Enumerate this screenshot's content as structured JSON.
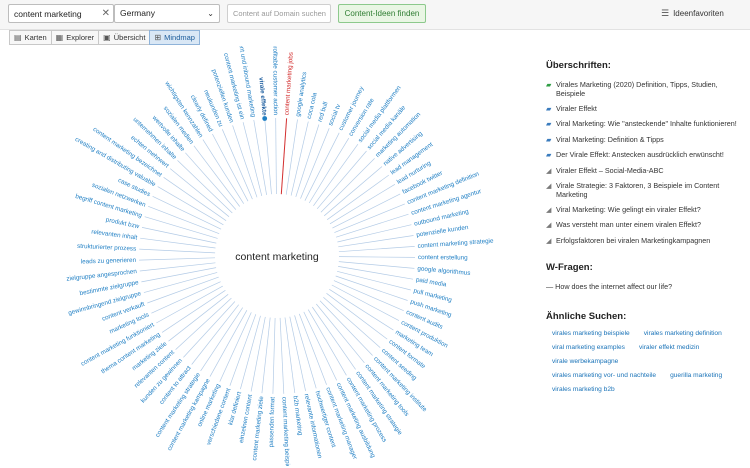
{
  "toolbar": {
    "search_value": "content marketing",
    "country": "Germany",
    "domain_placeholder": "Content auf Domain suchen",
    "find_button": "Content-Ideen finden",
    "favorites": "Ideenfavoriten"
  },
  "tabs": [
    {
      "label": "Karten",
      "icon": "map-icon",
      "active": false
    },
    {
      "label": "Explorer",
      "icon": "table-icon",
      "active": false
    },
    {
      "label": "Übersicht",
      "icon": "overview-icon",
      "active": false
    },
    {
      "label": "Mindmap",
      "icon": "mindmap-icon",
      "active": true
    }
  ],
  "mindmap": {
    "center": "content marketing",
    "colors": {
      "normal": "#1f7fc4",
      "highlight": "#d32f2f",
      "bold": "#1f5fa0",
      "line": "#b3cbe6"
    },
    "highlighted_index": 0,
    "bold_index": 77,
    "nodes": [
      "content marketing jobs",
      "google analytics",
      "coca cola",
      "red bull",
      "social tv",
      "customer journey",
      "conversion rate",
      "social media plattformen",
      "social media kanäle",
      "marketing automation",
      "native advertising",
      "lead management",
      "lead nurturing",
      "facebook twitter",
      "content marketing definition",
      "content marketing agentur",
      "outbound marketing",
      "potenzielle kunden",
      "content marketing strategie",
      "content erstellung",
      "google algorithmus",
      "paid media",
      "pull marketing",
      "push marketing",
      "content audits",
      "content produktion",
      "marketing team",
      "content formate",
      "content seeding",
      "content marketing institute",
      "content marketing tools",
      "content marketing strategie",
      "content marketing prozess",
      "content marketing ausbildung",
      "content marketing manager",
      "hochwertiger content",
      "relevante informationen",
      "b2b marketing",
      "content marketing beispiele",
      "passenden format",
      "content marketing ziele",
      "einzelnen content",
      "klar definiert",
      "verschiedene content",
      "online marketing",
      "content marketing kampagne",
      "content marketing strategie",
      "content to attract",
      "kunden zu gewinnen",
      "relevanten content",
      "marketing ziele",
      "thema content marketing",
      "content marketing funktioniert",
      "marketing tools",
      "content verkauft",
      "gewinnbringend zielgruppe",
      "bestimmte zielgruppe",
      "zielgruppe angesprochen",
      "leads zu generieren",
      "strukturierter prozess",
      "relevanten inhalt",
      "produkt bzw",
      "begriff content marketing",
      "sozialen netzwerken",
      "case studies",
      "creating and distributing valuable",
      "content marketing bezeichnet",
      "echten mehrwert",
      "unternehmen inhalte",
      "wertvolle inhalte",
      "sozialen medien",
      "wichtigsten kennzahlen",
      "clearly defined",
      "neukunden zu",
      "potenziellen kunden",
      "content marketing ist ein",
      "content und inbound marketing",
      "virale effekte",
      "profitable customer action"
    ]
  },
  "panel": {
    "headings_title": "Überschriften:",
    "headings": [
      {
        "text": "Virales Marketing (2020) Definition, Tipps, Studien, Beispiele",
        "icon": "book-icon"
      },
      {
        "text": "Viraler Effekt",
        "icon": "book-icon"
      },
      {
        "text": "Viral Marketing: Wie \"ansteckende\" Inhalte funktionieren!",
        "icon": "book-icon"
      },
      {
        "text": "Viral Marketing: Definition & Tipps",
        "icon": "book-icon"
      },
      {
        "text": "Der Virale Effekt: Anstecken ausdrücklich erwünscht!",
        "icon": "book-icon"
      },
      {
        "text": "Viraler Effekt – Social-Media-ABC",
        "icon": "megaphone-icon"
      },
      {
        "text": "Virale Strategie: 3 Faktoren, 3 Beispiele im Content Marketing",
        "icon": "megaphone-icon"
      },
      {
        "text": "Viral Marketing: Wie gelingt ein viraler Effekt?",
        "icon": "megaphone-icon"
      },
      {
        "text": "Was versteht man unter einem viralen Effekt?",
        "icon": "megaphone-icon"
      },
      {
        "text": "Erfolgsfaktoren bei viralen Marketingkampagnen",
        "icon": "megaphone-icon"
      }
    ],
    "wfragen_title": "W-Fragen:",
    "wfragen": [
      "— How does the internet affect our life?"
    ],
    "similar_title": "Ähnliche Suchen:",
    "similar": [
      "virales marketing beispiele",
      "virales marketing definition",
      "viral marketing examples",
      "viraler effekt medizin",
      "virale werbekampagne",
      "virales marketing vor- und nachteile",
      "guerilla marketing",
      "virales marketing b2b"
    ]
  }
}
